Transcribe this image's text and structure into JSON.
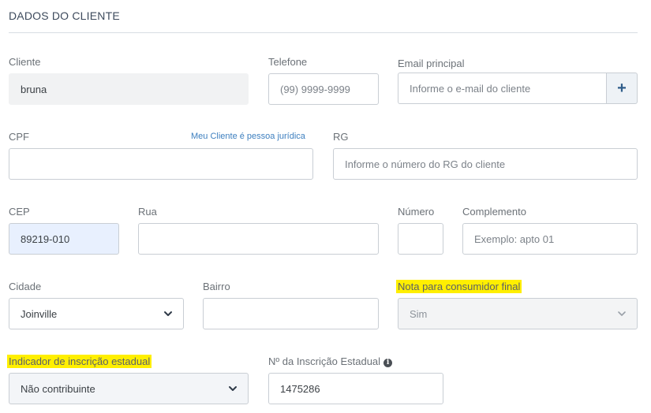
{
  "section": {
    "title": "DADOS DO CLIENTE"
  },
  "fields": {
    "cliente": {
      "label": "Cliente",
      "value": "bruna"
    },
    "telefone": {
      "label": "Telefone",
      "placeholder": "(99) 9999-9999"
    },
    "email": {
      "label": "Email principal",
      "placeholder": "Informe o e-mail do cliente",
      "add_label": "+"
    },
    "cpf": {
      "label": "CPF",
      "value": "",
      "link": "Meu Cliente é pessoa jurídica"
    },
    "rg": {
      "label": "RG",
      "placeholder": "Informe o número do RG do cliente"
    },
    "cep": {
      "label": "CEP",
      "value": "89219-010"
    },
    "rua": {
      "label": "Rua",
      "value": ""
    },
    "numero": {
      "label": "Número",
      "value": ""
    },
    "complemento": {
      "label": "Complemento",
      "placeholder": "Exemplo: apto 01"
    },
    "cidade": {
      "label": "Cidade",
      "value": "Joinville"
    },
    "bairro": {
      "label": "Bairro",
      "value": ""
    },
    "nota_consumidor": {
      "label": "Nota para consumidor final",
      "value": "Sim"
    },
    "indicador_ie": {
      "label": "Indicador de inscrição estadual",
      "value": "Não contribuinte"
    },
    "numero_ie": {
      "label": "Nº da Inscrição Estadual",
      "value": "1475286",
      "info_icon": "i"
    }
  },
  "colors": {
    "highlight": "#ffef00",
    "link": "#3d7fbf",
    "autofill": "#e8f0fe"
  }
}
